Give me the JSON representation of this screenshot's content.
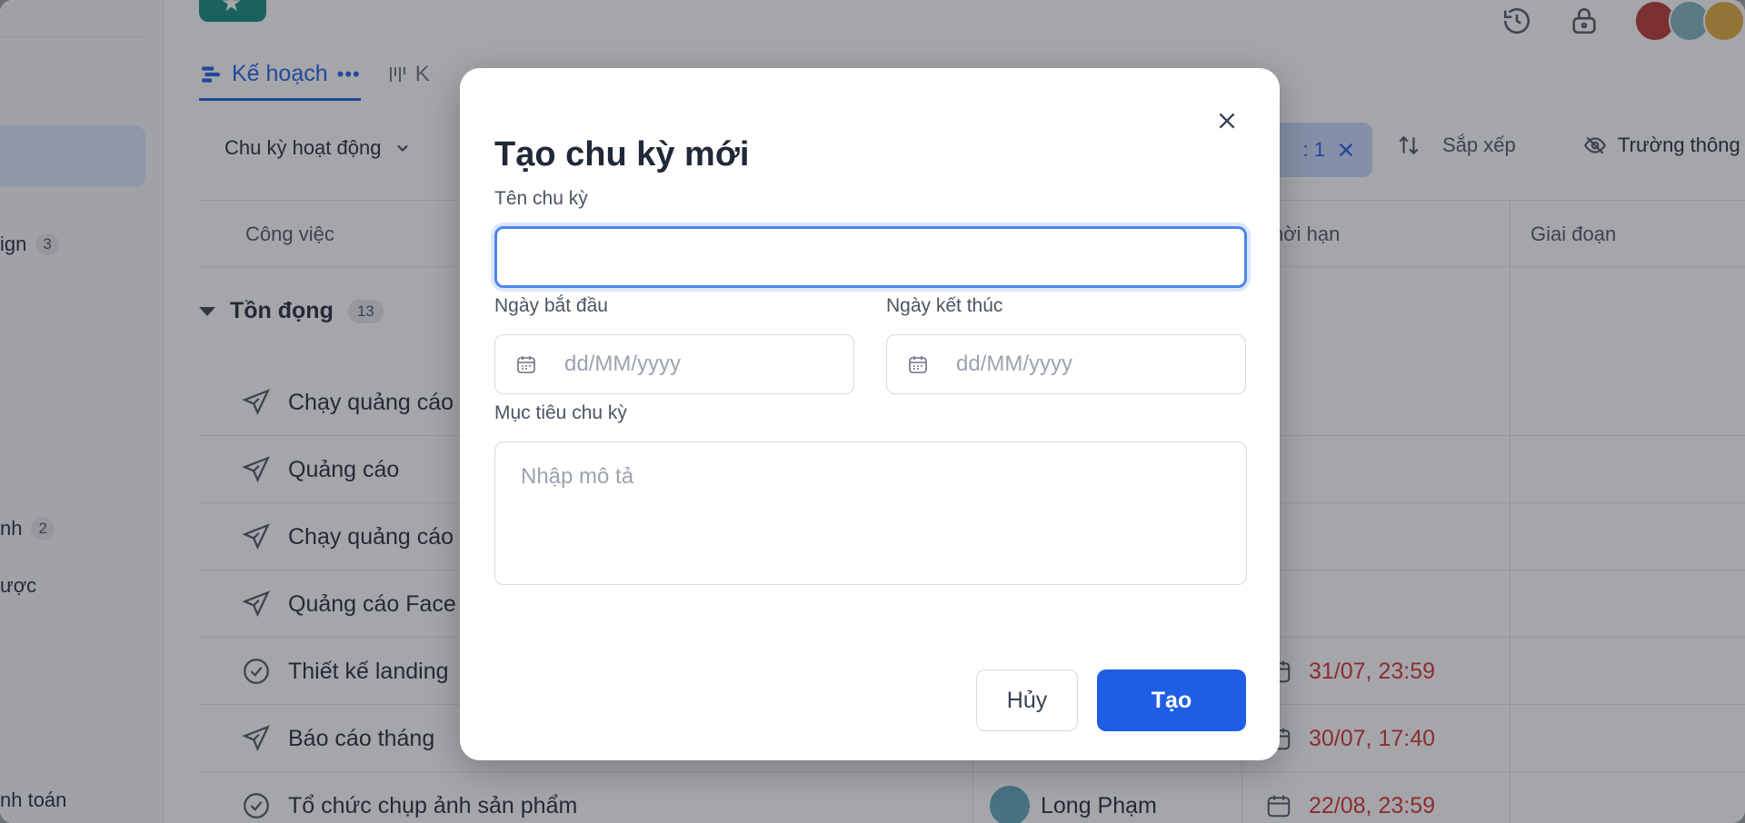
{
  "sidebar": {
    "items": [
      {
        "label": "ign",
        "count": "3"
      },
      {
        "label": "nh",
        "count": "2"
      },
      {
        "label": "ược"
      },
      {
        "label": "nh toán"
      }
    ]
  },
  "tabs": {
    "active_label": "Kế hoạch",
    "second_label": "K"
  },
  "toolbar": {
    "filter_label": "Chu kỳ hoạt động",
    "chip_label": ": 1",
    "sort_label": "Sắp xếp",
    "fields_label": "Trường thông"
  },
  "grid": {
    "columns": {
      "task": "Công việc",
      "deadline": "hời hạn",
      "stage": "Giai đoạn"
    },
    "group": {
      "label": "Tồn đọng",
      "count": "13"
    },
    "rows": [
      {
        "name": "Chạy quảng cáo",
        "icon": "send-icon"
      },
      {
        "name": "Quảng cáo",
        "icon": "send-icon"
      },
      {
        "name": "Chạy quảng cáo",
        "icon": "send-icon"
      },
      {
        "name": "Quảng cáo Face",
        "icon": "send-icon"
      },
      {
        "name": "Thiết kế landing",
        "icon": "check-circle-icon",
        "deadline": "31/07, 23:59"
      },
      {
        "name": "Báo cáo tháng",
        "icon": "send-icon",
        "deadline": "30/07, 17:40"
      },
      {
        "name": "Tổ chức chụp ảnh sản phẩm",
        "icon": "check-circle-icon",
        "owner": "Long Phạm",
        "deadline": "22/08, 23:59"
      }
    ]
  },
  "modal": {
    "title": "Tạo chu kỳ mới",
    "name_label": "Tên chu kỳ",
    "name_value": "",
    "start_label": "Ngày bắt đầu",
    "start_placeholder": "dd/MM/yyyy",
    "end_label": "Ngày kết thúc",
    "end_placeholder": "dd/MM/yyyy",
    "goal_label": "Mục tiêu chu kỳ",
    "goal_placeholder": "Nhập mô tả",
    "cancel_label": "Hủy",
    "create_label": "Tạo"
  },
  "colors": {
    "primary": "#1f5ee4",
    "deadline_overdue": "#d32f2f",
    "overlay": "rgba(40,44,52,0.42)"
  }
}
